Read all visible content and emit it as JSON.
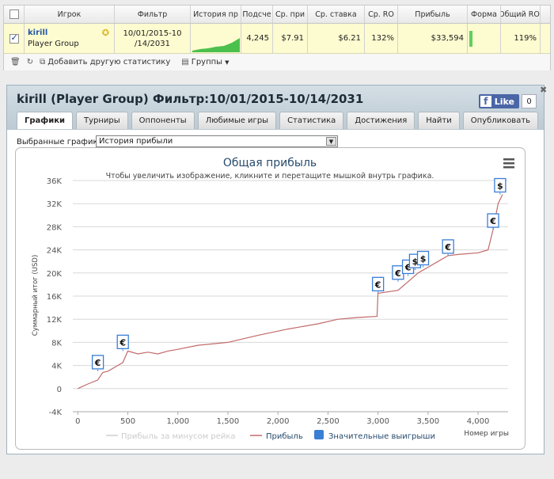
{
  "grid": {
    "headers": [
      "Игрок",
      "Фильтр",
      "История пр",
      "Подсче",
      "Ср. при",
      "Ср. ставка",
      "Ср. RO",
      "Прибыль",
      "Форма",
      "Общий RO:"
    ],
    "row": {
      "checked": true,
      "player_name": "kirill",
      "player_group": "Player Group",
      "filter_line1": "10/01/2015-10",
      "filter_line2": "/14/2031",
      "count": "4,245",
      "avg_prize": "$7.91",
      "avg_stake": "$6.21",
      "avg_roi": "132%",
      "profit": "$33,594",
      "total_roi": "119%"
    },
    "toolbar": {
      "add_stat": "Добавить другую статистику",
      "groups": "Группы"
    }
  },
  "window": {
    "title": "kirill (Player Group) Фильтр:10/01/2015-10/14/2031",
    "like_label": "Like",
    "like_count": "0",
    "tabs": [
      "Графики",
      "Турниры",
      "Оппоненты",
      "Любимые игры",
      "Статистика",
      "Достижения",
      "Найти",
      "Опубликовать"
    ],
    "active_tab": "Графики",
    "selector_label": "Выбранные графики:",
    "selector_value": "История прибыли"
  },
  "chart_data": {
    "type": "line",
    "title": "Общая прибыль",
    "subtitle": "Чтобы увеличить изображение, кликните и перетащите мышкой внутрь графика.",
    "ylabel": "Суммарный итог (USD)",
    "xlabel": "Номер игры",
    "ylim": [
      -4000,
      36000
    ],
    "xlim": [
      -50,
      4300
    ],
    "yticks": [
      "-4K",
      "0",
      "4K",
      "8K",
      "12K",
      "16K",
      "20K",
      "24K",
      "28K",
      "32K",
      "36K"
    ],
    "xticks": [
      "0",
      "500",
      "1,000",
      "1,500",
      "2,000",
      "2,500",
      "3,000",
      "3,500",
      "4,000"
    ],
    "legend": [
      "Прибыль за минусом рейка",
      "Прибыль",
      "Значительные выигрыши"
    ],
    "colors": {
      "profit": "#c26a6a",
      "rake": "#cfcfcf",
      "flags": "#3a7ed6"
    },
    "series": [
      {
        "name": "Прибыль",
        "x": [
          0,
          100,
          200,
          250,
          300,
          400,
          450,
          500,
          600,
          700,
          800,
          900,
          1000,
          1200,
          1500,
          1800,
          2100,
          2400,
          2600,
          2800,
          2990,
          3000,
          3200,
          3300,
          3400,
          3500,
          3600,
          3700,
          3800,
          4000,
          4100,
          4150,
          4200,
          4245
        ],
        "y": [
          0,
          800,
          1500,
          2800,
          3000,
          4000,
          4500,
          6500,
          6000,
          6300,
          6000,
          6500,
          6800,
          7500,
          8000,
          9200,
          10300,
          11200,
          12000,
          12300,
          12500,
          16500,
          17000,
          18500,
          20000,
          21000,
          22000,
          23000,
          23200,
          23500,
          24000,
          27500,
          32000,
          33600
        ]
      }
    ],
    "big_wins": [
      {
        "x": 200,
        "y": 3000,
        "label": "€"
      },
      {
        "x": 450,
        "y": 6500,
        "label": "€"
      },
      {
        "x": 3000,
        "y": 16500,
        "label": "€"
      },
      {
        "x": 3200,
        "y": 18500,
        "label": "€"
      },
      {
        "x": 3300,
        "y": 19500,
        "label": "€"
      },
      {
        "x": 3370,
        "y": 20500,
        "label": "$"
      },
      {
        "x": 3450,
        "y": 21000,
        "label": "$"
      },
      {
        "x": 3700,
        "y": 23000,
        "label": "€"
      },
      {
        "x": 4150,
        "y": 27500,
        "label": "€"
      },
      {
        "x": 4220,
        "y": 33600,
        "label": "$"
      }
    ]
  }
}
